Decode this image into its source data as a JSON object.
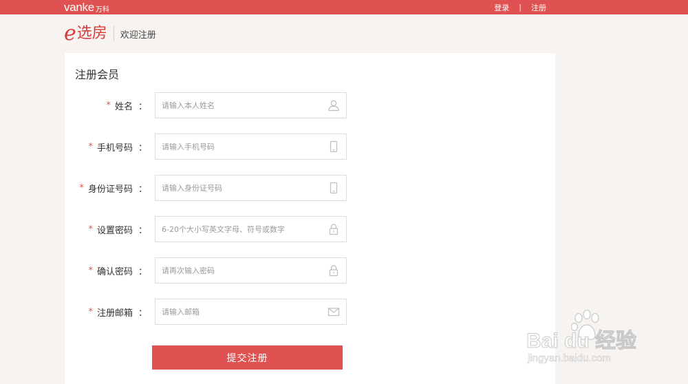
{
  "topbar": {
    "brand_wordmark": "vanke",
    "brand_cn": "万科",
    "login_link": "登录",
    "separator": "|",
    "register_link": "注册",
    "bg_color": "#e05252"
  },
  "header": {
    "logo_e": "e",
    "logo_text": "选房",
    "subtitle": "欢迎注册"
  },
  "form": {
    "title": "注册会员",
    "required_mark": "*",
    "colon": "：",
    "fields": [
      {
        "label": "姓名",
        "placeholder": "请输入本人姓名",
        "icon": "user-icon"
      },
      {
        "label": "手机号码",
        "placeholder": "请输入手机号码",
        "icon": "phone-icon"
      },
      {
        "label": "身份证号码",
        "placeholder": "请输入身份证号码",
        "icon": "phone-icon"
      },
      {
        "label": "设置密码",
        "placeholder": "6-20个大小写英文字母、符号或数字",
        "icon": "lock-icon"
      },
      {
        "label": "确认密码",
        "placeholder": "请再次输入密码",
        "icon": "lock-icon"
      },
      {
        "label": "注册邮箱",
        "placeholder": "请输入邮箱",
        "icon": "mail-icon"
      }
    ],
    "submit_label": "提交注册"
  },
  "watermark": {
    "main": "Bai du 经验",
    "sub": "jingyan.baidu.com"
  },
  "colors": {
    "accent": "#e05252",
    "page_bg": "#f6f3f1",
    "border": "#dcdcdc"
  }
}
